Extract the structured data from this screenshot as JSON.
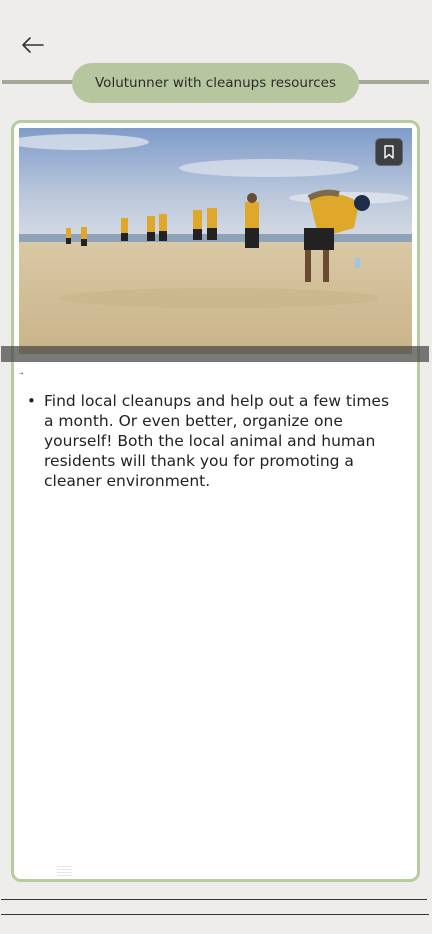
{
  "header": {
    "title": "Volutunner with cleanups resources"
  },
  "card": {
    "image_alt": "Volunteers picking up trash on a beach",
    "link_text": "→",
    "bullets": [
      "Find local cleanups and help out a few times a month. Or even better, organize one yourself! Both the local animal and human residents will thank you for promoting a cleaner environment."
    ]
  },
  "icons": {
    "back": "arrow-left-icon",
    "bookmark": "bookmark-icon"
  },
  "colors": {
    "background": "#efedeb",
    "pill": "#b6c69f",
    "card_border": "#b5cd9c",
    "bookmark_bg": "#3d3f42"
  }
}
